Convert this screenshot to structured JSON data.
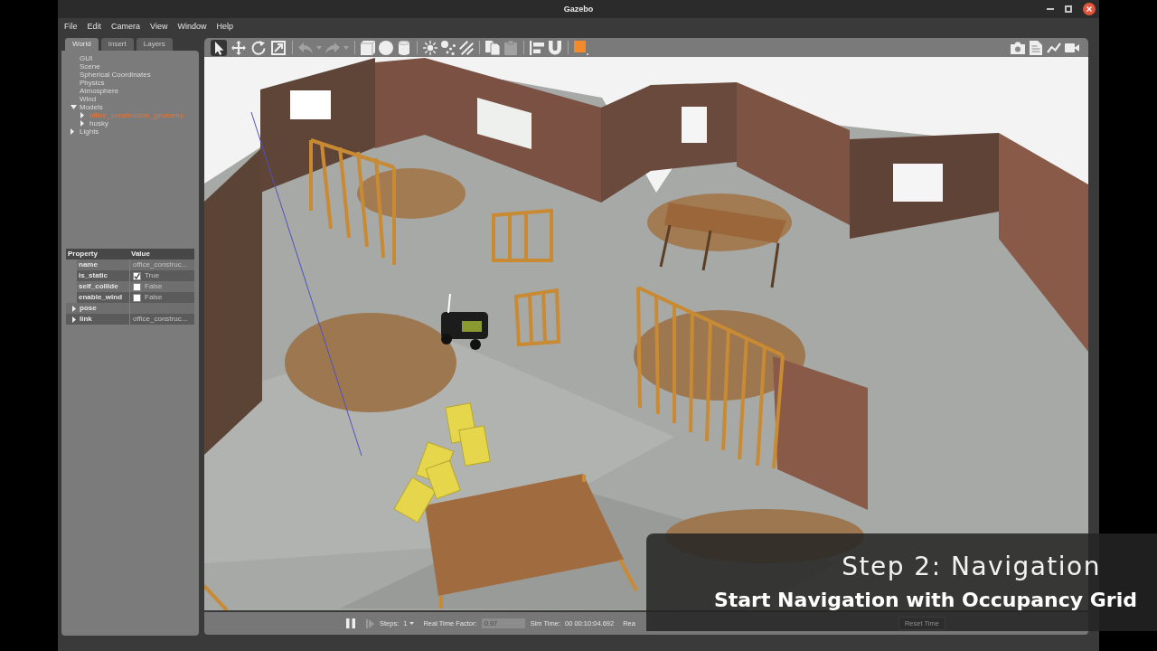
{
  "window": {
    "title": "Gazebo",
    "controls": [
      {
        "kind": "minimize"
      },
      {
        "kind": "maximize"
      },
      {
        "kind": "close"
      }
    ]
  },
  "menu": [
    {
      "label": "File"
    },
    {
      "label": "Edit"
    },
    {
      "label": "Camera"
    },
    {
      "label": "View"
    },
    {
      "label": "Window"
    },
    {
      "label": "Help"
    }
  ],
  "left_panel": {
    "tabs": [
      {
        "label": "World",
        "selected": true
      },
      {
        "label": "Insert",
        "selected": false
      },
      {
        "label": "Layers",
        "selected": false
      }
    ],
    "tree": [
      {
        "label": "GUI",
        "kind": "leaf",
        "selected": false
      },
      {
        "label": "Scene",
        "kind": "leaf",
        "selected": false
      },
      {
        "label": "Spherical Coordinates",
        "kind": "leaf",
        "selected": false
      },
      {
        "label": "Physics",
        "kind": "leaf",
        "selected": false
      },
      {
        "label": "Atmosphere",
        "kind": "leaf",
        "selected": false
      },
      {
        "label": "Wind",
        "kind": "leaf",
        "selected": false
      },
      {
        "label": "Models",
        "kind": "branch",
        "expanded": true,
        "selected": false,
        "children": [
          {
            "label": "office_construction_geometry",
            "kind": "branch",
            "expanded": false,
            "selected": true
          },
          {
            "label": "husky",
            "kind": "branch",
            "expanded": false,
            "selected": false
          }
        ]
      },
      {
        "label": "Lights",
        "kind": "branch",
        "expanded": false,
        "selected": false
      }
    ],
    "properties": {
      "columns": [
        "Property",
        "Value"
      ],
      "rows": [
        {
          "kind": "text",
          "property": "name",
          "value": "office_construc..."
        },
        {
          "kind": "checkbox",
          "property": "is_static",
          "checked": true,
          "value": "True"
        },
        {
          "kind": "checkbox",
          "property": "self_collide",
          "checked": false,
          "value": "False"
        },
        {
          "kind": "checkbox",
          "property": "enable_wind",
          "checked": false,
          "value": "False"
        },
        {
          "kind": "group",
          "property": "pose",
          "expanded": false
        },
        {
          "kind": "group",
          "property": "link",
          "expanded": false,
          "value": "office_construc..."
        }
      ]
    }
  },
  "toolbar": {
    "modes": [
      {
        "kind": "select",
        "selected": true
      },
      {
        "kind": "translate",
        "selected": false
      },
      {
        "kind": "rotate",
        "selected": false
      },
      {
        "kind": "scale",
        "selected": false
      }
    ],
    "history": [
      {
        "kind": "undo",
        "disabled": true
      },
      {
        "kind": "undo_menu",
        "disabled": true
      },
      {
        "kind": "redo",
        "disabled": true
      },
      {
        "kind": "redo_menu",
        "disabled": true
      }
    ],
    "shapes": [
      {
        "kind": "box"
      },
      {
        "kind": "sphere"
      },
      {
        "kind": "cylinder"
      }
    ],
    "lights": [
      {
        "kind": "point"
      },
      {
        "kind": "spot"
      },
      {
        "kind": "directional"
      }
    ],
    "clipboard": [
      {
        "kind": "copy",
        "disabled": false
      },
      {
        "kind": "paste",
        "disabled": true
      }
    ],
    "snapping": [
      {
        "kind": "align"
      },
      {
        "kind": "snap"
      }
    ],
    "view": [
      {
        "kind": "view_angle"
      }
    ],
    "right": [
      {
        "kind": "screenshot"
      },
      {
        "kind": "log"
      },
      {
        "kind": "plot"
      },
      {
        "kind": "record"
      }
    ]
  },
  "status_bar": {
    "playback": {
      "kind": "pause"
    },
    "step": {
      "disabled": true
    },
    "steps_label": "Steps:",
    "steps_value": "1",
    "rtf_label": "Real Time Factor:",
    "rtf_value": "0.97",
    "sim_time_label": "Sim Time:",
    "sim_time_value": "00 00:10:04.692",
    "real_time_label": "Rea",
    "reset_button": "Reset Time"
  },
  "caption": {
    "title": "Step 2: Navigation",
    "subtitle": "Start Navigation with Occupancy Grid"
  }
}
